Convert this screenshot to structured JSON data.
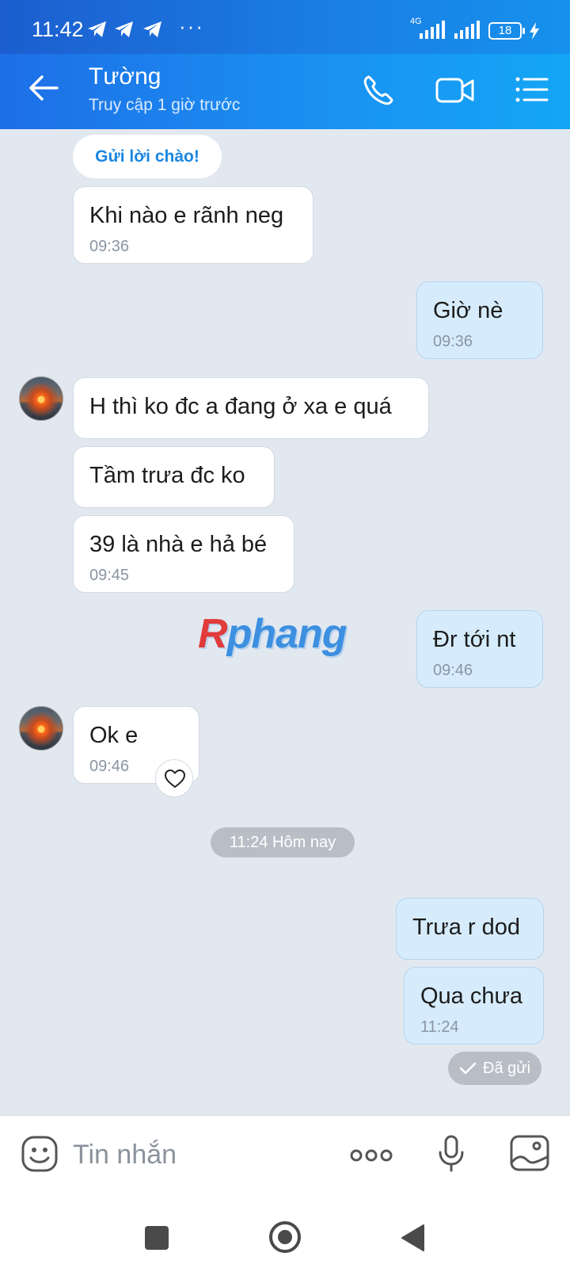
{
  "status_bar": {
    "time": "11:42",
    "overflow": "···",
    "network": "4G",
    "battery": "18"
  },
  "header": {
    "contact_name": "Tường",
    "last_seen": "Truy cập 1 giờ trước"
  },
  "chat": {
    "greeting_chip": "Gửi lời chào!",
    "messages": [
      {
        "from": "them",
        "text": "Khi nào e rãnh neg",
        "time": "09:36"
      },
      {
        "from": "me",
        "text": "Giờ nè",
        "time": "09:36"
      },
      {
        "from": "them",
        "text": "H thì ko đc a đang ở xa e quá",
        "time": ""
      },
      {
        "from": "them",
        "text": "Tầm trưa đc ko",
        "time": ""
      },
      {
        "from": "them",
        "text": "39 là nhà e hả bé",
        "time": "09:45"
      },
      {
        "from": "me",
        "text": "Đr tới nt",
        "time": "09:46"
      },
      {
        "from": "them",
        "text": "Ok e",
        "time": "09:46"
      },
      {
        "from": "me",
        "text": "Trưa r dod",
        "time": ""
      },
      {
        "from": "me",
        "text": "Qua chưa",
        "time": "11:24"
      }
    ],
    "day_separator": "11:24 Hôm nay",
    "delivery_status": "Đã gửi"
  },
  "watermark": {
    "prefix": "R",
    "rest": "phang"
  },
  "composer": {
    "placeholder": "Tin nhắn"
  },
  "icons": {
    "back": "arrow-left-icon",
    "call": "phone-icon",
    "video": "video-camera-icon",
    "menu": "list-menu-icon",
    "emoji": "sticker-face-icon",
    "more": "more-dots-icon",
    "mic": "microphone-icon",
    "image": "image-icon"
  },
  "colors": {
    "header": "#1a86ec",
    "outgoing_bubble": "#d6ecfd",
    "incoming_bubble": "#ffffff",
    "background": "#e2e8f0"
  }
}
